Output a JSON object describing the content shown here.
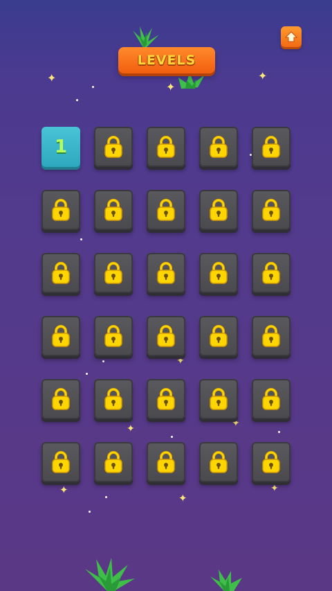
{
  "header": {
    "title": "LEVELS",
    "home_icon": "home-icon"
  },
  "levels": [
    {
      "label": "1",
      "state": "unlocked"
    },
    {
      "label": "",
      "state": "locked"
    },
    {
      "label": "",
      "state": "locked"
    },
    {
      "label": "",
      "state": "locked"
    },
    {
      "label": "",
      "state": "locked"
    },
    {
      "label": "",
      "state": "locked"
    },
    {
      "label": "",
      "state": "locked"
    },
    {
      "label": "",
      "state": "locked"
    },
    {
      "label": "",
      "state": "locked"
    },
    {
      "label": "",
      "state": "locked"
    },
    {
      "label": "",
      "state": "locked"
    },
    {
      "label": "",
      "state": "locked"
    },
    {
      "label": "",
      "state": "locked"
    },
    {
      "label": "",
      "state": "locked"
    },
    {
      "label": "",
      "state": "locked"
    },
    {
      "label": "",
      "state": "locked"
    },
    {
      "label": "",
      "state": "locked"
    },
    {
      "label": "",
      "state": "locked"
    },
    {
      "label": "",
      "state": "locked"
    },
    {
      "label": "",
      "state": "locked"
    },
    {
      "label": "",
      "state": "locked"
    },
    {
      "label": "",
      "state": "locked"
    },
    {
      "label": "",
      "state": "locked"
    },
    {
      "label": "",
      "state": "locked"
    },
    {
      "label": "",
      "state": "locked"
    },
    {
      "label": "",
      "state": "locked"
    },
    {
      "label": "",
      "state": "locked"
    },
    {
      "label": "",
      "state": "locked"
    },
    {
      "label": "",
      "state": "locked"
    },
    {
      "label": "",
      "state": "locked"
    }
  ],
  "icons": {
    "locked": "lock-icon",
    "decoration": "plant-icon"
  },
  "colors": {
    "background": "#523a8c",
    "title_plate": "#f25e10",
    "title_text": "#ffd93a",
    "unlocked_tile": "#2ea8bd",
    "locked_tile": "#4a4a4e",
    "lock": "#ffd600",
    "level_number": "#b6ff5e"
  }
}
